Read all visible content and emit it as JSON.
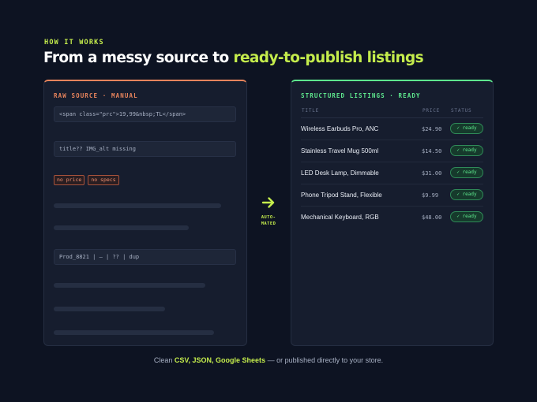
{
  "header": {
    "eyebrow": "HOW IT WORKS",
    "headline_prefix": "From a messy source to ",
    "headline_highlight": "ready-to-publish listings"
  },
  "raw_source": {
    "label": "RAW SOURCE · MANUAL",
    "code_lines": [
      "<span class=\"prc\">19,99&nbsp;TL</span>",
      "title??   IMG_alt missing",
      "Prod_8821 | — | ?? | dup"
    ],
    "tags": [
      "no price",
      "no specs"
    ]
  },
  "arrow": {
    "line1": "AUTO-",
    "line2": "MATED"
  },
  "structured": {
    "label": "STRUCTURED LISTINGS · READY",
    "columns": [
      "TITLE",
      "PRICE",
      "STATUS"
    ],
    "rows": [
      {
        "title": "Wireless Earbuds Pro, ANC",
        "price": "$24.90",
        "status": "✓ ready"
      },
      {
        "title": "Stainless Travel Mug 500ml",
        "price": "$14.50",
        "status": "✓ ready"
      },
      {
        "title": "LED Desk Lamp, Dimmable",
        "price": "$31.00",
        "status": "✓ ready"
      },
      {
        "title": "Phone Tripod Stand, Flexible",
        "price": "$9.99",
        "status": "✓ ready"
      },
      {
        "title": "Mechanical Keyboard, RGB",
        "price": "$48.00",
        "status": "✓ ready"
      }
    ]
  },
  "footer": {
    "prefix": "Clean ",
    "highlight": "CSV, JSON, Google Sheets",
    "suffix": " — or published directly to your store."
  },
  "colors": {
    "background": "#0d1322",
    "accent_lime": "#c4ec4c",
    "raw_orange": "#e8845c",
    "ready_green": "#5ee88e"
  },
  "icons": {
    "arrow": "arrow-right-icon"
  }
}
